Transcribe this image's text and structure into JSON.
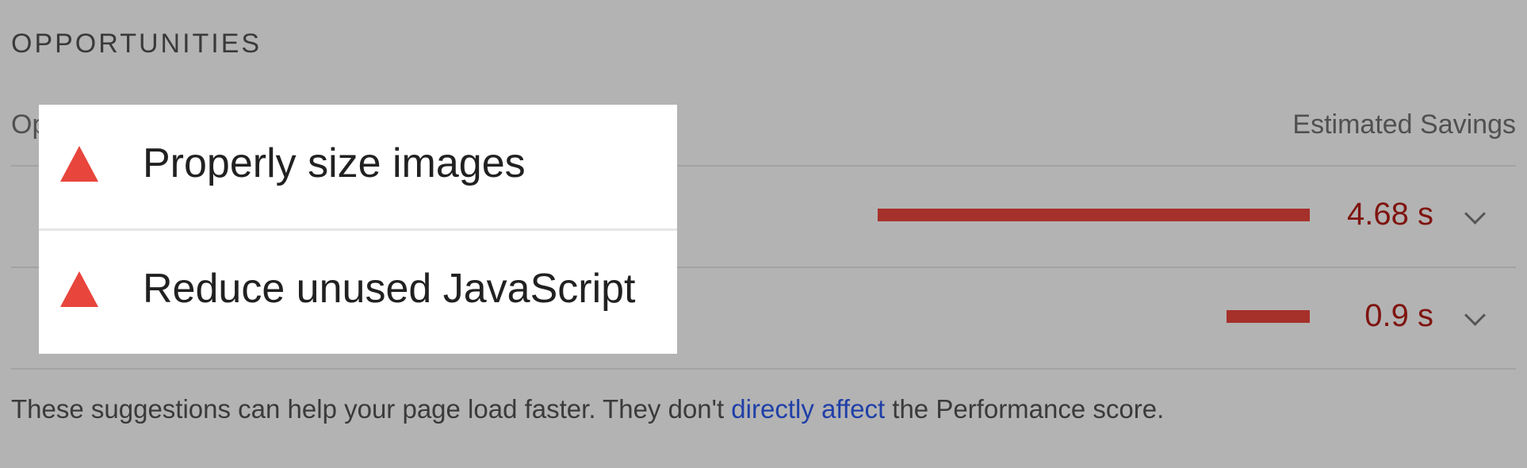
{
  "section": {
    "title": "OPPORTUNITIES"
  },
  "table": {
    "column_opportunity_label": "Op",
    "column_savings_label": "Estimated Savings",
    "rows": [
      {
        "title": "Properly size images",
        "savings": "4.68 s",
        "savings_seconds": 4.68,
        "icon": "warning-triangle-icon"
      },
      {
        "title": "Reduce unused JavaScript",
        "savings": "0.9 s",
        "savings_seconds": 0.9,
        "icon": "warning-triangle-icon"
      }
    ]
  },
  "footer": {
    "text_before": "These suggestions can help your page load faster. They don't ",
    "link_text": "directly affect",
    "text_after": " the Performance score."
  },
  "colors": {
    "background": "#b3b3b3",
    "bar": "#a6302a",
    "savings_text": "#7f1410",
    "warning": "#e8453c",
    "link": "#1f3fa8"
  }
}
